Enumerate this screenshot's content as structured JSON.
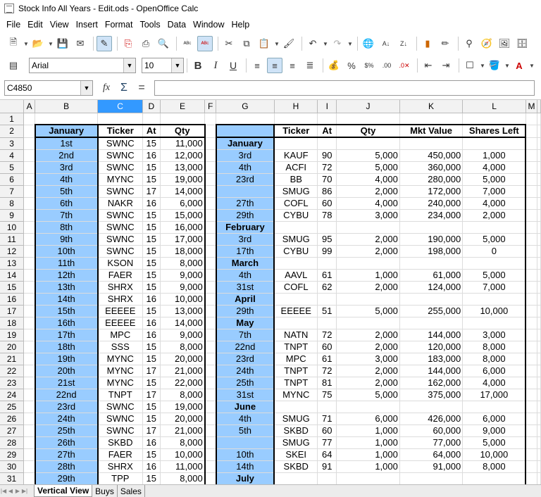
{
  "window_title": "Stock Info All Years - Edit.ods - OpenOffice Calc",
  "menu": [
    "File",
    "Edit",
    "View",
    "Insert",
    "Format",
    "Tools",
    "Data",
    "Window",
    "Help"
  ],
  "font_name": "Arial",
  "font_size": "10",
  "name_box": "C4850",
  "formula": "",
  "columns": [
    "A",
    "B",
    "C",
    "D",
    "E",
    "F",
    "G",
    "H",
    "I",
    "J",
    "K",
    "L",
    "M"
  ],
  "selected_column": "C",
  "rows": [
    [
      "",
      "",
      "",
      "",
      "",
      "",
      "",
      "",
      "",
      "",
      "",
      "",
      ""
    ],
    [
      "",
      "January",
      "Ticker",
      "At",
      "Qty",
      "",
      "",
      "Ticker",
      "At",
      "Qty",
      "Mkt Value",
      "Shares Left",
      ""
    ],
    [
      "",
      "1st",
      "SWNC",
      "15",
      "11,000",
      "",
      "January",
      "",
      "",
      "",
      "",
      "",
      ""
    ],
    [
      "",
      "2nd",
      "SWNC",
      "16",
      "12,000",
      "",
      "3rd",
      "KAUF",
      "90",
      "5,000",
      "450,000",
      "1,000",
      ""
    ],
    [
      "",
      "3rd",
      "SWNC",
      "15",
      "13,000",
      "",
      "4th",
      "ACFI",
      "72",
      "5,000",
      "360,000",
      "4,000",
      ""
    ],
    [
      "",
      "4th",
      "MYNC",
      "15",
      "19,000",
      "",
      "23rd",
      "BB",
      "70",
      "4,000",
      "280,000",
      "5,000",
      ""
    ],
    [
      "",
      "5th",
      "SWNC",
      "17",
      "14,000",
      "",
      "",
      "SMUG",
      "86",
      "2,000",
      "172,000",
      "7,000",
      ""
    ],
    [
      "",
      "6th",
      "NAKR",
      "16",
      "6,000",
      "",
      "27th",
      "COFL",
      "60",
      "4,000",
      "240,000",
      "4,000",
      ""
    ],
    [
      "",
      "7th",
      "SWNC",
      "15",
      "15,000",
      "",
      "29th",
      "CYBU",
      "78",
      "3,000",
      "234,000",
      "2,000",
      ""
    ],
    [
      "",
      "8th",
      "SWNC",
      "15",
      "16,000",
      "",
      "February",
      "",
      "",
      "",
      "",
      "",
      ""
    ],
    [
      "",
      "9th",
      "SWNC",
      "15",
      "17,000",
      "",
      "3rd",
      "SMUG",
      "95",
      "2,000",
      "190,000",
      "5,000",
      ""
    ],
    [
      "",
      "10th",
      "SWNC",
      "15",
      "18,000",
      "",
      "17th",
      "CYBU",
      "99",
      "2,000",
      "198,000",
      "0",
      ""
    ],
    [
      "",
      "11th",
      "KSON",
      "15",
      "8,000",
      "",
      "March",
      "",
      "",
      "",
      "",
      "",
      ""
    ],
    [
      "",
      "12th",
      "FAER",
      "15",
      "9,000",
      "",
      "4th",
      "AAVL",
      "61",
      "1,000",
      "61,000",
      "5,000",
      ""
    ],
    [
      "",
      "13th",
      "SHRX",
      "15",
      "9,000",
      "",
      "31st",
      "COFL",
      "62",
      "2,000",
      "124,000",
      "7,000",
      ""
    ],
    [
      "",
      "14th",
      "SHRX",
      "16",
      "10,000",
      "",
      "April",
      "",
      "",
      "",
      "",
      "",
      ""
    ],
    [
      "",
      "15th",
      "EEEEE",
      "15",
      "13,000",
      "",
      "29th",
      "EEEEE",
      "51",
      "5,000",
      "255,000",
      "10,000",
      ""
    ],
    [
      "",
      "16th",
      "EEEEE",
      "16",
      "14,000",
      "",
      "May",
      "",
      "",
      "",
      "",
      "",
      ""
    ],
    [
      "",
      "17th",
      "MPC",
      "16",
      "9,000",
      "",
      "7th",
      "NATN",
      "72",
      "2,000",
      "144,000",
      "3,000",
      ""
    ],
    [
      "",
      "18th",
      "SSS",
      "15",
      "8,000",
      "",
      "22nd",
      "TNPT",
      "60",
      "2,000",
      "120,000",
      "8,000",
      ""
    ],
    [
      "",
      "19th",
      "MYNC",
      "15",
      "20,000",
      "",
      "23rd",
      "MPC",
      "61",
      "3,000",
      "183,000",
      "8,000",
      ""
    ],
    [
      "",
      "20th",
      "MYNC",
      "17",
      "21,000",
      "",
      "24th",
      "TNPT",
      "72",
      "2,000",
      "144,000",
      "6,000",
      ""
    ],
    [
      "",
      "21st",
      "MYNC",
      "15",
      "22,000",
      "",
      "25th",
      "TNPT",
      "81",
      "2,000",
      "162,000",
      "4,000",
      ""
    ],
    [
      "",
      "22nd",
      "TNPT",
      "17",
      "8,000",
      "",
      "31st",
      "MYNC",
      "75",
      "5,000",
      "375,000",
      "17,000",
      ""
    ],
    [
      "",
      "23rd",
      "SWNC",
      "15",
      "19,000",
      "",
      "June",
      "",
      "",
      "",
      "",
      "",
      ""
    ],
    [
      "",
      "24th",
      "SWNC",
      "15",
      "20,000",
      "",
      "4th",
      "SMUG",
      "71",
      "6,000",
      "426,000",
      "6,000",
      ""
    ],
    [
      "",
      "25th",
      "SWNC",
      "17",
      "21,000",
      "",
      "5th",
      "SKBD",
      "60",
      "1,000",
      "60,000",
      "9,000",
      ""
    ],
    [
      "",
      "26th",
      "SKBD",
      "16",
      "8,000",
      "",
      "",
      "SMUG",
      "77",
      "1,000",
      "77,000",
      "5,000",
      ""
    ],
    [
      "",
      "27th",
      "FAER",
      "15",
      "10,000",
      "",
      "10th",
      "SKEI",
      "64",
      "1,000",
      "64,000",
      "10,000",
      ""
    ],
    [
      "",
      "28th",
      "SHRX",
      "16",
      "11,000",
      "",
      "14th",
      "SKBD",
      "91",
      "1,000",
      "91,000",
      "8,000",
      ""
    ],
    [
      "",
      "29th",
      "TPP",
      "15",
      "8,000",
      "",
      "July",
      "",
      "",
      "",
      "",
      "",
      ""
    ]
  ],
  "sheet_tabs": [
    "Vertical View",
    "Buys",
    "Sales"
  ],
  "active_tab": "Vertical View",
  "colors": {
    "blue_fill": "#99ccff",
    "header_selected": "#3399ff"
  }
}
